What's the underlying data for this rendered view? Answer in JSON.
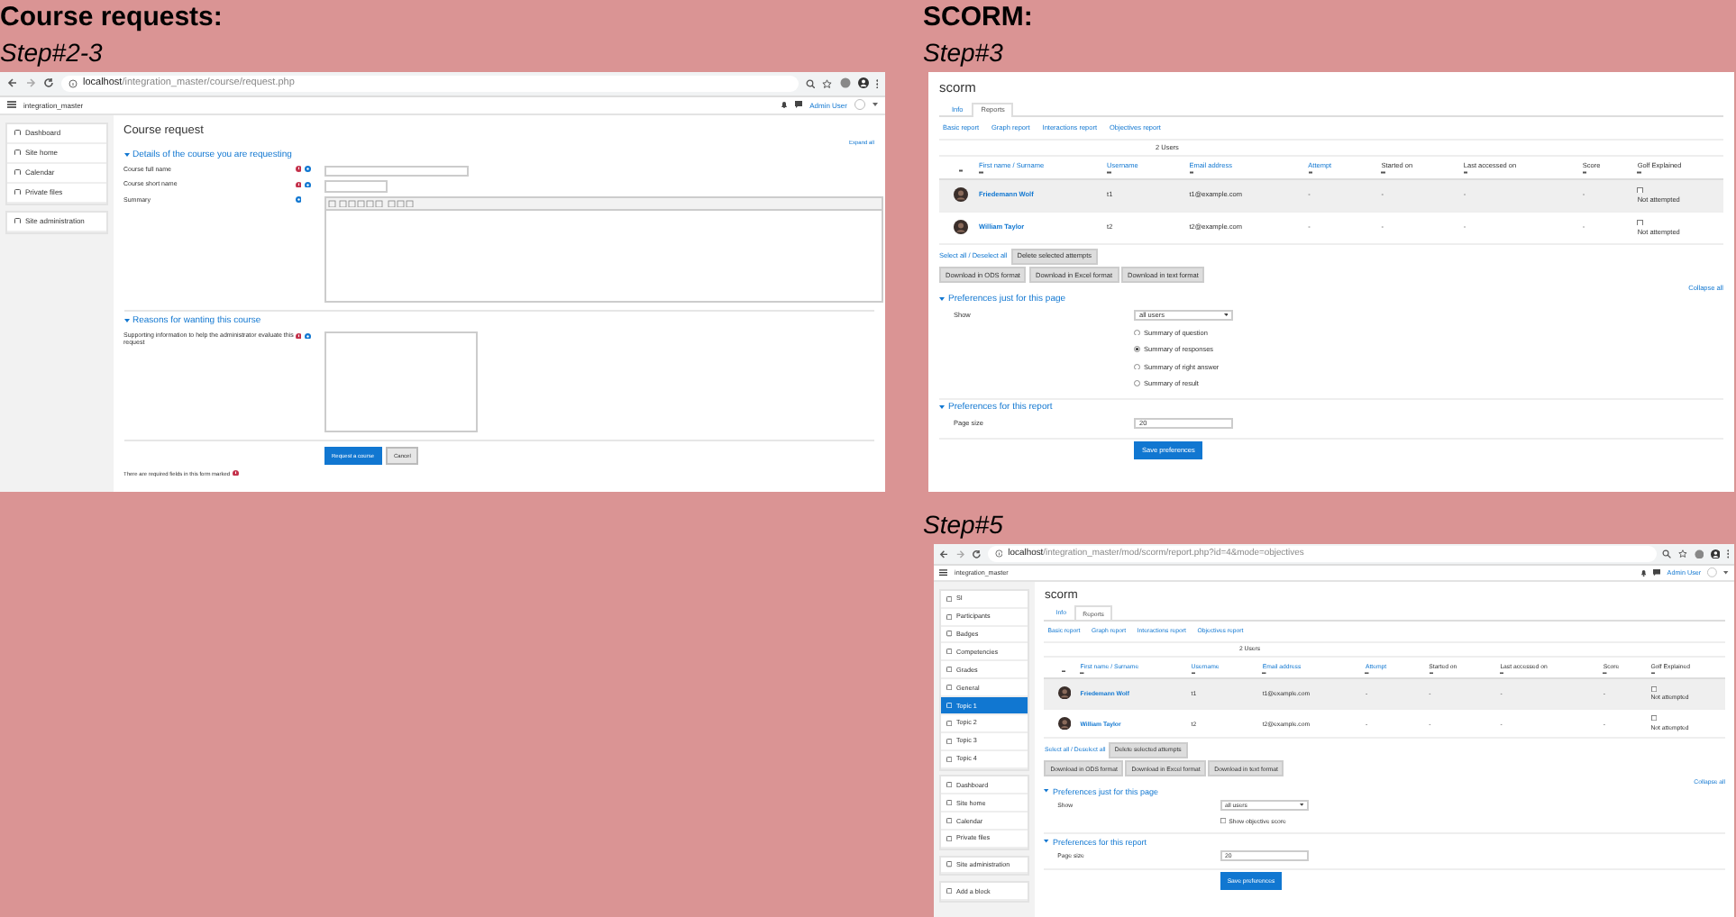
{
  "course_requests": {
    "heading": "Course requests:",
    "step": "Step#2-3",
    "screenshot": {
      "browser": {
        "host": "localhost",
        "path": "/integration_master/course/request.php"
      },
      "navbar": {
        "site": "integration_master",
        "user": "Admin User"
      },
      "sidebar": [
        [
          {
            "label": "Dashboard",
            "selected": false
          },
          {
            "label": "Site home",
            "selected": false
          },
          {
            "label": "Calendar",
            "selected": false
          },
          {
            "label": "Private files",
            "selected": false
          }
        ],
        [
          {
            "label": "Site administration",
            "selected": false
          }
        ]
      ],
      "page": {
        "kind": "course_request",
        "title": "Course request",
        "expand_all": "Expand all",
        "sections": [
          {
            "title": "Details of the course you are requesting",
            "fields": [
              {
                "kind": "text",
                "label": "Course full name",
                "required": true
              },
              {
                "kind": "short",
                "label": "Course short name",
                "required": true
              },
              {
                "kind": "editor",
                "label": "Summary",
                "required": false
              }
            ]
          },
          {
            "title": "Reasons for wanting this course",
            "fields": [
              {
                "kind": "textarea",
                "label": "Supporting information to help the administrator evaluate this request",
                "required": true
              }
            ]
          }
        ],
        "buttons": [
          {
            "label": "Request a course",
            "primary": true
          },
          {
            "label": "Cancel",
            "primary": false
          }
        ],
        "required_note": "There are required fields in this form marked"
      }
    }
  },
  "scorm": {
    "heading": "SCORM:",
    "steps": [
      {
        "label": "Step#3",
        "screenshot": {
          "page": {
            "kind": "scorm_report",
            "title": "scorm",
            "tabs": [
              {
                "label": "Info",
                "selected": false
              },
              {
                "label": "Reports",
                "selected": true
              }
            ],
            "report_links": [
              "Basic report",
              "Graph report",
              "Interactions report",
              "Objectives report"
            ],
            "count": "2 Users",
            "columns": [
              {
                "label": "First name / Surname",
                "link": true
              },
              {
                "label": "Username",
                "link": true
              },
              {
                "label": "Email address",
                "link": true
              },
              {
                "label": "Attempt",
                "link": true
              },
              {
                "label": "Started on",
                "link": false
              },
              {
                "label": "Last accessed on",
                "link": false
              },
              {
                "label": "Score",
                "link": false
              },
              {
                "label": "Golf Explained",
                "link": false
              }
            ],
            "rows": [
              {
                "cells": [
                  "Friedemann Wolf",
                  "t1",
                  "t1@example.com",
                  "-",
                  "-",
                  "-",
                  "-"
                ],
                "checked": false,
                "status": "Not attempted"
              },
              {
                "cells": [
                  "William Taylor",
                  "t2",
                  "t2@example.com",
                  "-",
                  "-",
                  "-",
                  "-"
                ],
                "checked": false,
                "status": "Not attempted"
              }
            ],
            "select_all": "Select all / Deselect all",
            "delete_button": "Delete selected attempts",
            "downloads": [
              "Download in ODS format",
              "Download in Excel format",
              "Download in text format"
            ],
            "collapse_all": "Collapse all",
            "preferences": [
              {
                "title": "Preferences just for this page",
                "items": [
                  {
                    "kind": "select",
                    "label": "Show",
                    "value": "all users"
                  },
                  {
                    "kind": "radio",
                    "label": "Summary of question",
                    "selected": false
                  },
                  {
                    "kind": "radio",
                    "label": "Summary of responses",
                    "selected": true
                  },
                  {
                    "kind": "radio",
                    "label": "Summary of right answer",
                    "selected": false
                  },
                  {
                    "kind": "radio",
                    "label": "Summary of result",
                    "selected": false
                  }
                ]
              },
              {
                "title": "Preferences for this report",
                "items": [
                  {
                    "kind": "text",
                    "label": "Page size",
                    "value": "20"
                  }
                ]
              }
            ],
            "submit": "Save preferences"
          }
        }
      },
      {
        "label": "Step#5",
        "screenshot": {
          "browser": {
            "host": "localhost",
            "path": "/integration_master/mod/scorm/report.php?id=4&mode=objectives"
          },
          "navbar": {
            "site": "integration_master",
            "user": "Admin User"
          },
          "sidebar": [
            [
              {
                "label": "SI",
                "selected": false
              },
              {
                "label": "Participants",
                "selected": false
              },
              {
                "label": "Badges",
                "selected": false
              },
              {
                "label": "Competencies",
                "selected": false
              },
              {
                "label": "Grades",
                "selected": false
              },
              {
                "label": "General",
                "selected": false
              },
              {
                "label": "Topic 1",
                "selected": true
              },
              {
                "label": "Topic 2",
                "selected": false
              },
              {
                "label": "Topic 3",
                "selected": false
              },
              {
                "label": "Topic 4",
                "selected": false
              }
            ],
            [
              {
                "label": "Dashboard",
                "selected": false
              },
              {
                "label": "Site home",
                "selected": false
              },
              {
                "label": "Calendar",
                "selected": false
              },
              {
                "label": "Private files",
                "selected": false
              }
            ],
            [
              {
                "label": "Site administration",
                "selected": false
              }
            ],
            [
              {
                "label": "Add a block",
                "selected": false
              }
            ]
          ],
          "page": {
            "kind": "scorm_report",
            "title": "scorm",
            "tabs": [
              {
                "label": "Info",
                "selected": false
              },
              {
                "label": "Reports",
                "selected": true
              }
            ],
            "report_links": [
              "Basic report",
              "Graph report",
              "Interactions report",
              "Objectives report"
            ],
            "count": "2 Users",
            "columns": [
              {
                "label": "First name / Surname",
                "link": true
              },
              {
                "label": "Username",
                "link": true
              },
              {
                "label": "Email address",
                "link": true
              },
              {
                "label": "Attempt",
                "link": true
              },
              {
                "label": "Started on",
                "link": false
              },
              {
                "label": "Last accessed on",
                "link": false
              },
              {
                "label": "Score",
                "link": false
              },
              {
                "label": "Golf Explained",
                "link": false
              }
            ],
            "rows": [
              {
                "cells": [
                  "Friedemann Wolf",
                  "t1",
                  "t1@example.com",
                  "-",
                  "-",
                  "-",
                  "-"
                ],
                "checked": false,
                "status": "Not attempted"
              },
              {
                "cells": [
                  "William Taylor",
                  "t2",
                  "t2@example.com",
                  "-",
                  "-",
                  "-",
                  "-"
                ],
                "checked": false,
                "status": "Not attempted"
              }
            ],
            "select_all": "Select all / Deselect all",
            "delete_button": "Delete selected attempts",
            "downloads": [
              "Download in ODS format",
              "Download in Excel format",
              "Download in text format"
            ],
            "collapse_all": "Collapse all",
            "preferences": [
              {
                "title": "Preferences just for this page",
                "items": [
                  {
                    "kind": "select",
                    "label": "Show",
                    "value": "all users"
                  },
                  {
                    "kind": "checkbox",
                    "label": "Show objective score",
                    "checked": false
                  }
                ]
              },
              {
                "title": "Preferences for this report",
                "items": [
                  {
                    "kind": "text",
                    "label": "Page size",
                    "value": "20"
                  }
                ]
              }
            ],
            "submit": "Save preferences"
          }
        }
      }
    ]
  }
}
